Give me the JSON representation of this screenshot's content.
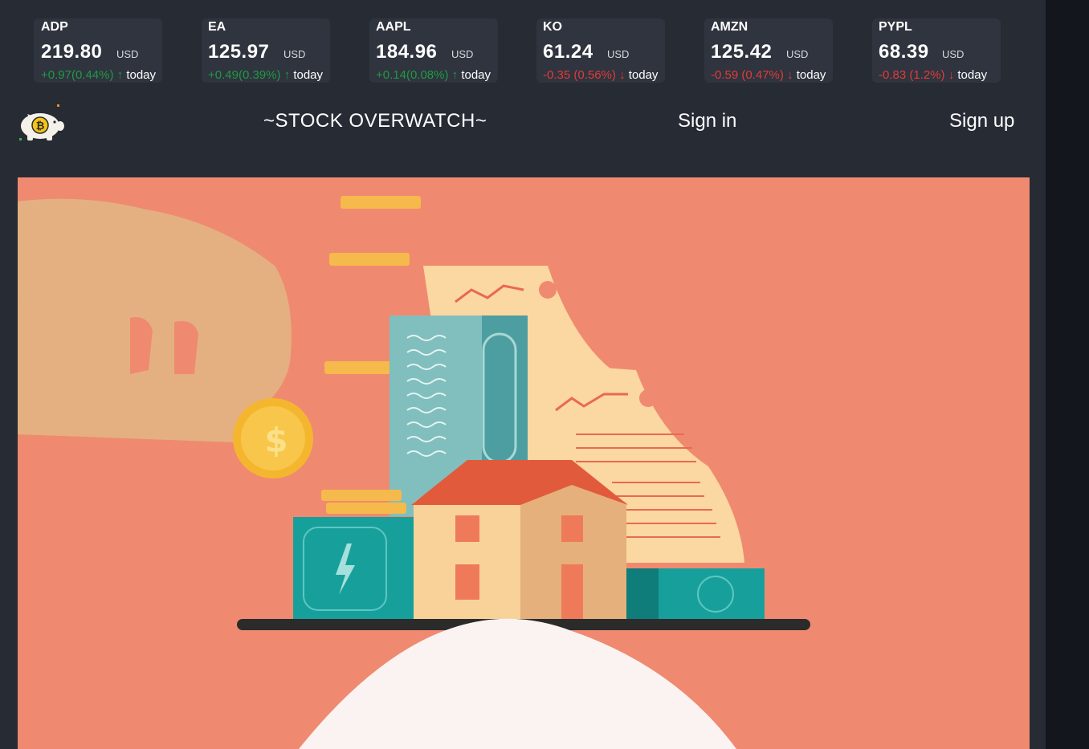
{
  "tickers": [
    {
      "symbol": "ADP",
      "price": "219.80",
      "currency": "USD",
      "change": "+0.97(0.44%)",
      "arrow": "↑",
      "when": "today",
      "direction": "up"
    },
    {
      "symbol": "EA",
      "price": "125.97",
      "currency": "USD",
      "change": "+0.49(0.39%)",
      "arrow": "↑",
      "when": "today",
      "direction": "up"
    },
    {
      "symbol": "AAPL",
      "price": "184.96",
      "currency": "USD",
      "change": "+0.14(0.08%)",
      "arrow": "↑",
      "when": "today",
      "direction": "up"
    },
    {
      "symbol": "KO",
      "price": "61.24",
      "currency": "USD",
      "change": "-0.35 (0.56%)",
      "arrow": "↓",
      "when": "today",
      "direction": "down"
    },
    {
      "symbol": "AMZN",
      "price": "125.42",
      "currency": "USD",
      "change": "-0.59 (0.47%)",
      "arrow": "↓",
      "when": "today",
      "direction": "down"
    },
    {
      "symbol": "PYPL",
      "price": "68.39",
      "currency": "USD",
      "change": "-0.83 (1.2%)",
      "arrow": "↓",
      "when": "today",
      "direction": "down"
    }
  ],
  "nav": {
    "brand": "~STOCK OVERWATCH~",
    "sign_in": "Sign in",
    "sign_up": "Sign up",
    "logo_icon": "piggy-bank-bitcoin-icon"
  },
  "hero": {
    "illustration": "hand-coin-house-investment-illustration"
  },
  "colors": {
    "background": "#262b34",
    "ticker_card": "#2f343e",
    "up": "#1f9a45",
    "down": "#e23b3b",
    "hero": "#ef8a70"
  }
}
